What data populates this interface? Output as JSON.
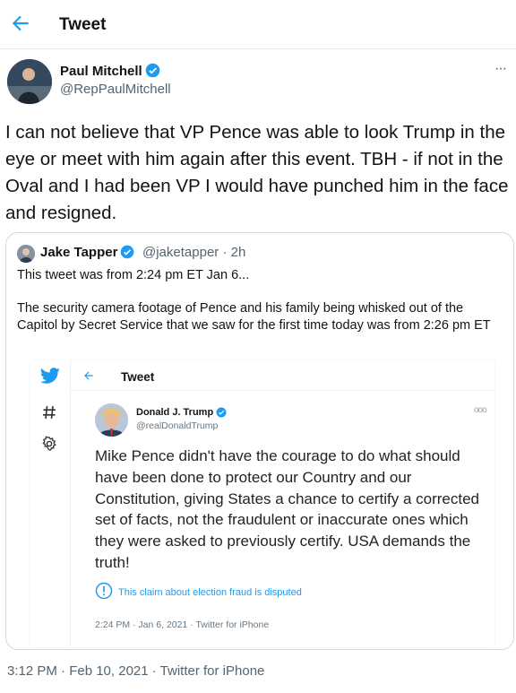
{
  "header": {
    "title": "Tweet",
    "back_icon": "back-arrow-icon"
  },
  "author": {
    "name": "Paul Mitchell",
    "handle": "@RepPaulMitchell",
    "verified": true,
    "more_label": "···"
  },
  "tweet": {
    "text": "I can not believe that VP Pence was able to look Trump in the eye or meet with him again after this event. TBH - if not in the Oval and I had been VP I would have punched him in the face and resigned.",
    "timestamp": "3:12 PM · Feb 10, 2021 · Twitter for iPhone"
  },
  "quoted": {
    "name": "Jake Tapper",
    "meta": "@jaketapper · 2h",
    "verified": true,
    "line1": "This tweet was from 2:24 pm ET Jan 6...",
    "line2": "The security camera footage of Pence and his family being whisked out of the Capitol by Secret Service that we saw for the first time today was from 2:26 pm ET"
  },
  "embedded": {
    "header_title": "Tweet",
    "side_icons": [
      "twitter-bird-icon",
      "hashtag-icon",
      "gear-icon"
    ],
    "name": "Donald J. Trump",
    "handle": "@realDonaldTrump",
    "more_label": "ooo",
    "text": "Mike Pence didn't have the courage to do what should have been done to protect our Country and our Constitution, giving States a chance to certify a corrected set of facts, not the fraudulent or inaccurate ones which they were asked to previously certify. USA demands the truth!",
    "dispute": "This claim about election fraud is disputed",
    "footer": "2:24 PM · Jan 6, 2021 · Twitter for iPhone"
  },
  "colors": {
    "accent": "#1d9bf0",
    "muted": "#536471",
    "border": "#cfd9de"
  }
}
